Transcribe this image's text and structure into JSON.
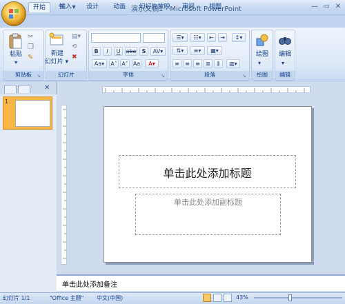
{
  "window": {
    "title": "演示文稿1 - Microsoft PowerPoint",
    "min_glyph": "—",
    "max_glyph": "▭",
    "close_glyph": "✕"
  },
  "qat": {
    "save_icon": "💾",
    "undo_icon": "↶",
    "redo_icon": "↷",
    "more_icon": "▾"
  },
  "tabs": [
    {
      "label": "开始",
      "active": true
    },
    {
      "label": "插入"
    },
    {
      "label": "设计"
    },
    {
      "label": "动画"
    },
    {
      "label": "幻灯片放映"
    },
    {
      "label": "审阅"
    },
    {
      "label": "视图"
    }
  ],
  "ribbon": {
    "clipboard": {
      "label": "剪贴板",
      "paste": "粘贴"
    },
    "slides": {
      "label": "幻灯片",
      "new_slide_line1": "新建",
      "new_slide_line2": "幻灯片 ▾"
    },
    "font": {
      "label": "字体",
      "bold": "B",
      "italic": "I",
      "underline": "U",
      "strike": "abe",
      "shadow": "S",
      "spacing": "AV▾",
      "case": "Aa▾",
      "grow": "A˄",
      "shrink": "A˅",
      "color": "A▾",
      "clear": "Aa"
    },
    "paragraph": {
      "label": "段落"
    },
    "drawing": {
      "label": "绘图"
    },
    "editing": {
      "label": "编辑"
    }
  },
  "slide": {
    "title_placeholder": "单击此处添加标题",
    "subtitle_placeholder": "单击此处添加副标题"
  },
  "thumbnail": {
    "number": "1"
  },
  "notes": {
    "placeholder": "单击此处添加备注"
  },
  "status": {
    "slide_count": "幻灯片 1/1",
    "theme": "\"Office 主题\"",
    "language": "中文(中国)",
    "zoom": "43%"
  },
  "colors": {
    "accent_orange": "#f7b645",
    "ribbon_blue": "#dbe7f7",
    "text_blue": "#15428b"
  }
}
